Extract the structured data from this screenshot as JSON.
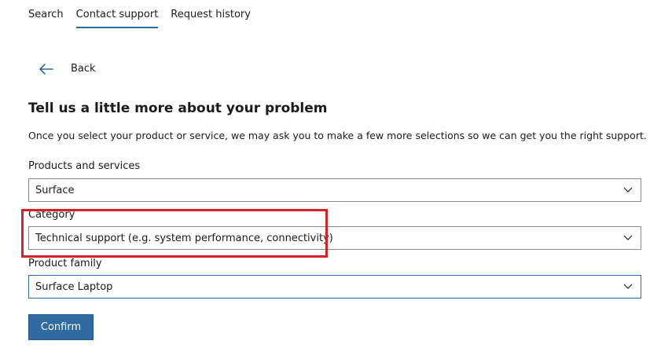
{
  "tabs": [
    {
      "label": "Search"
    },
    {
      "label": "Contact support"
    },
    {
      "label": "Request history"
    }
  ],
  "back": {
    "label": "Back"
  },
  "form": {
    "heading": "Tell us a little more about your problem",
    "description": "Once you select your product or service, we may ask you to make a few more selections so we can get you the right support.",
    "products": {
      "label": "Products and services",
      "value": "Surface"
    },
    "category": {
      "label": "Category",
      "value": "Technical support (e.g. system performance, connectivity)"
    },
    "family": {
      "label": "Product family",
      "value": "Surface Laptop"
    },
    "confirm_label": "Confirm"
  },
  "colors": {
    "accent": "#2f6aa0",
    "highlight": "#d61f26"
  },
  "icons": {
    "back": "arrow-left-icon",
    "dropdown": "chevron-down-icon"
  }
}
